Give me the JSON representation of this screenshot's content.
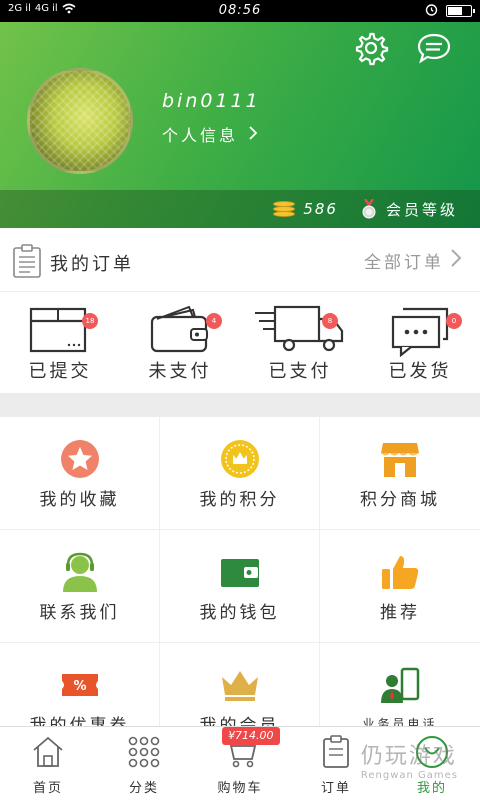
{
  "status_bar": {
    "carrier_left": "2G il",
    "carrier_mid": "4G il",
    "time": "08:56",
    "battery_level": 0.6
  },
  "profile": {
    "username": "bin0111",
    "info_label": "个人信息",
    "points": "586",
    "member_level": "会员等级"
  },
  "orders": {
    "title": "我的订单",
    "all_label": "全部订单",
    "statuses": [
      {
        "label": "已提交",
        "badge": "18"
      },
      {
        "label": "未支付",
        "badge": "4"
      },
      {
        "label": "已支付",
        "badge": "8"
      },
      {
        "label": "已发货",
        "badge": "0"
      }
    ]
  },
  "menu": [
    {
      "label": "我的收藏",
      "icon": "star-circle-icon",
      "color": "#f0826a"
    },
    {
      "label": "我的积分",
      "icon": "points-medal-icon",
      "color": "#f2c31c"
    },
    {
      "label": "积分商城",
      "icon": "store-icon",
      "color": "#f0a020"
    },
    {
      "label": "联系我们",
      "icon": "support-agent-icon",
      "color": "#7cc04a"
    },
    {
      "label": "我的钱包",
      "icon": "wallet-icon",
      "color": "#2e8b3e"
    },
    {
      "label": "推荐",
      "icon": "thumbs-up-icon",
      "color": "#f5a623"
    },
    {
      "label": "我的优惠券",
      "icon": "coupon-icon",
      "color": "#e8552a"
    },
    {
      "label": "我的会员",
      "icon": "crown-icon",
      "color": "#e0b048"
    },
    {
      "label": "业务员电话",
      "icon": "salesperson-phone-icon",
      "color": "#2e7d32"
    }
  ],
  "tabbar": {
    "tabs": [
      {
        "label": "首页",
        "icon": "home-icon"
      },
      {
        "label": "分类",
        "icon": "category-grid-icon"
      },
      {
        "label": "购物车",
        "icon": "cart-icon"
      },
      {
        "label": "订单",
        "icon": "order-icon"
      },
      {
        "label": "我的",
        "icon": "profile-icon"
      }
    ],
    "cart_price": "¥714.00",
    "active_index": 4
  },
  "watermark": {
    "text": "仍玩游戏",
    "sub": "Rengwan Games"
  },
  "colors": {
    "accent": "#2e9b3a",
    "badge": "#f25a5a"
  }
}
